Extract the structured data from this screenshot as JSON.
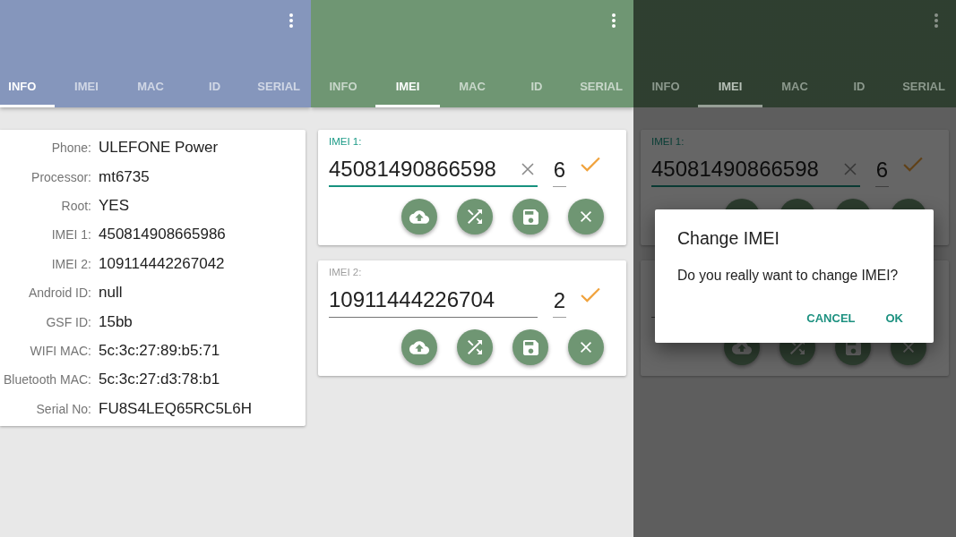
{
  "screens": [
    {
      "kind": "info",
      "dimmed": false,
      "tabs": [
        {
          "label": "INFO",
          "selected": true
        },
        {
          "label": "IMEI",
          "selected": false
        },
        {
          "label": "MAC",
          "selected": false
        },
        {
          "label": "ID",
          "selected": false
        },
        {
          "label": "SERIAL",
          "selected": false
        }
      ],
      "info_rows": [
        {
          "label": "Phone:",
          "value": "ULEFONE Power"
        },
        {
          "label": "Processor:",
          "value": "mt6735"
        },
        {
          "label": "Root:",
          "value": "YES"
        },
        {
          "label": "IMEI 1:",
          "value": "450814908665986"
        },
        {
          "label": "IMEI 2:",
          "value": "109114442267042"
        },
        {
          "label": "Android ID:",
          "value": "null"
        },
        {
          "label": "GSF ID:",
          "value": "15bb"
        },
        {
          "label": "WIFI MAC:",
          "value": "5c:3c:27:89:b5:71"
        },
        {
          "label": "Bluetooth MAC:",
          "value": "5c:3c:27:d3:78:b1"
        },
        {
          "label": "Serial No:",
          "value": "FU8S4LEQ65RC5L6H"
        }
      ]
    },
    {
      "kind": "imei",
      "dimmed": false,
      "tabs": [
        {
          "label": "INFO",
          "selected": false
        },
        {
          "label": "IMEI",
          "selected": true
        },
        {
          "label": "MAC",
          "selected": false
        },
        {
          "label": "ID",
          "selected": false
        },
        {
          "label": "SERIAL",
          "selected": false
        }
      ],
      "imei_cards": [
        {
          "label": "IMEI 1:",
          "value": "45081490866598",
          "check_digit": "6",
          "focused": true
        },
        {
          "label": "IMEI 2:",
          "value": "10911444226704",
          "check_digit": "2",
          "focused": false
        }
      ]
    },
    {
      "kind": "imei",
      "dimmed": true,
      "tabs": [
        {
          "label": "INFO",
          "selected": false
        },
        {
          "label": "IMEI",
          "selected": true
        },
        {
          "label": "MAC",
          "selected": false
        },
        {
          "label": "ID",
          "selected": false
        },
        {
          "label": "SERIAL",
          "selected": false
        }
      ],
      "imei_cards": [
        {
          "label": "IMEI 1:",
          "value": "45081490866598",
          "check_digit": "6",
          "focused": true
        },
        {
          "focused": false
        }
      ],
      "dialog": {
        "title": "Change IMEI",
        "message": "Do you really want to change IMEI?",
        "buttons": [
          "CANCEL",
          "OK"
        ]
      }
    }
  ]
}
